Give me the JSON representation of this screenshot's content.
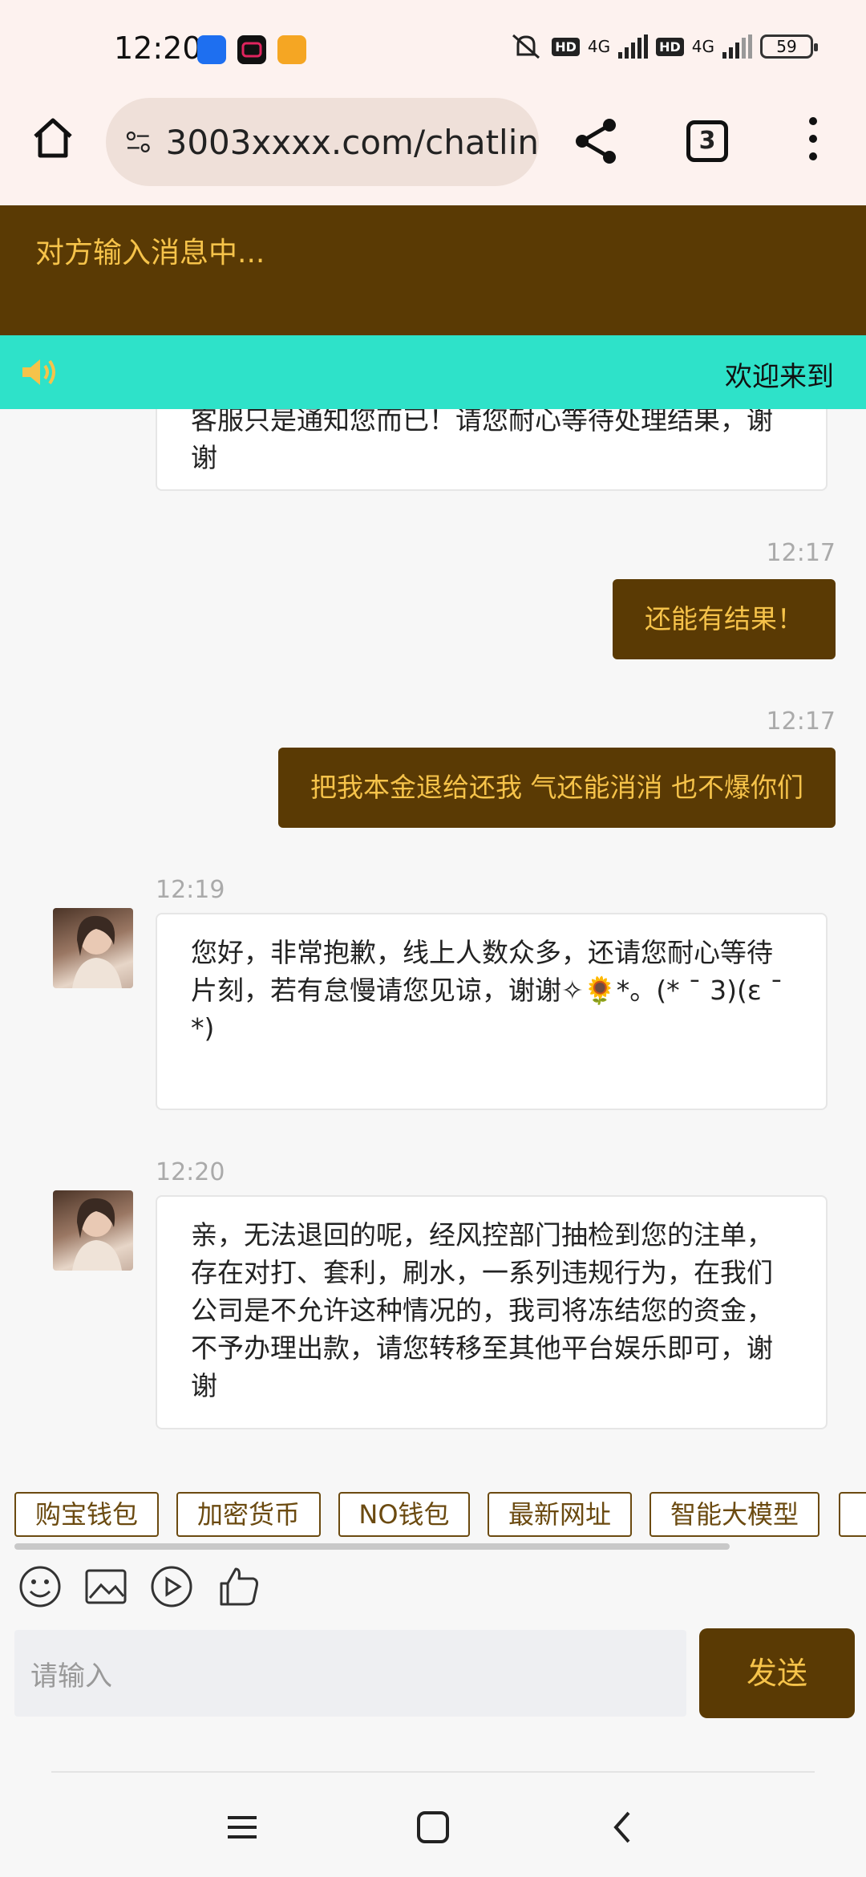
{
  "status_bar": {
    "time": "12:20",
    "network_1": "4G",
    "network_2": "4G",
    "battery": "59"
  },
  "browser": {
    "url": "3003xxxx.com/chatlin",
    "tab_count": "3"
  },
  "chat": {
    "typing_status": "对方输入消息中...",
    "notice": "欢迎来到"
  },
  "messages": [
    {
      "side": "in",
      "text": "客服只是通知您而已！请您耐心等待处理结果，谢谢",
      "time": ""
    },
    {
      "side": "out",
      "text": "还能有结果！",
      "time": "12:17"
    },
    {
      "side": "out",
      "text": "把我本金退给还我 气还能消消 也不爆你们",
      "time": "12:17"
    },
    {
      "side": "in",
      "text": "您好，非常抱歉，线上人数众多，还请您耐心等待片刻，若有怠慢请您见谅，谢谢✧🌻*。(* ˉ 3)(ε ˉ *)",
      "time": "12:19"
    },
    {
      "side": "in",
      "text": "亲，无法退回的呢，经风控部门抽检到您的注单，存在对打、套利，刷水，一系列违规行为，在我们公司是不允许这种情况的，我司将冻结您的资金，不予办理出款，请您转移至其他平台娱乐即可，谢谢",
      "time": "12:20"
    }
  ],
  "quick_links": [
    "购宝钱包",
    "加密货币",
    "NO钱包",
    "最新网址",
    "智能大模型"
  ],
  "input": {
    "placeholder": "请输入",
    "send_label": "发送"
  },
  "colors": {
    "brand_brown": "#5a3a04",
    "accent_gold": "#f6c34a",
    "notice_teal": "#2ee2c9"
  }
}
